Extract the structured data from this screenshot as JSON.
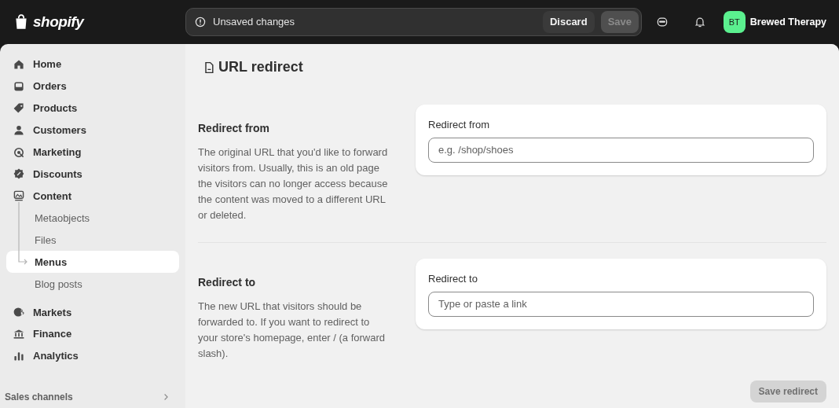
{
  "topbar": {
    "logo": "shopify",
    "notice": "Unsaved changes",
    "buttons": [
      {
        "label": "Discard",
        "disabled": false
      },
      {
        "label": "Save",
        "disabled": true
      }
    ],
    "avatar": "BT",
    "store": "Brewed Therapy"
  },
  "sidebar": {
    "items": [
      {
        "label": "Home",
        "selected": false
      },
      {
        "label": "Orders",
        "selected": false
      },
      {
        "label": "Products",
        "selected": false
      },
      {
        "label": "Customers",
        "selected": false
      },
      {
        "label": "Marketing",
        "selected": false
      },
      {
        "label": "Discounts",
        "selected": false
      },
      {
        "label": "Content",
        "selected": false,
        "expanded": true,
        "children": [
          {
            "label": "Metaobjects",
            "selected": false
          },
          {
            "label": "Files",
            "selected": false
          },
          {
            "label": "Menus",
            "selected": true
          },
          {
            "label": "Blog posts",
            "selected": false
          }
        ]
      },
      {
        "label": "Markets",
        "selected": false
      },
      {
        "label": "Finance",
        "selected": false
      },
      {
        "label": "Analytics",
        "selected": false
      }
    ],
    "section": "Sales channels"
  },
  "page": {
    "title": "URL redirect",
    "sections": [
      {
        "heading": "Redirect from",
        "description": "The original URL that you'd like to forward visitors from. Usually, this is an old page the visitors can no longer access because the content was moved to a different URL or deleted.",
        "field_label": "Redirect from",
        "placeholder": "e.g. /shop/shoes"
      },
      {
        "heading": "Redirect to",
        "description": "The new URL that visitors should be forwarded to. If you want to redirect to your store's homepage, enter / (a forward slash).",
        "field_label": "Redirect to",
        "placeholder": "Type or paste a link"
      }
    ],
    "save_button": {
      "label": "Save redirect",
      "disabled": true
    }
  }
}
